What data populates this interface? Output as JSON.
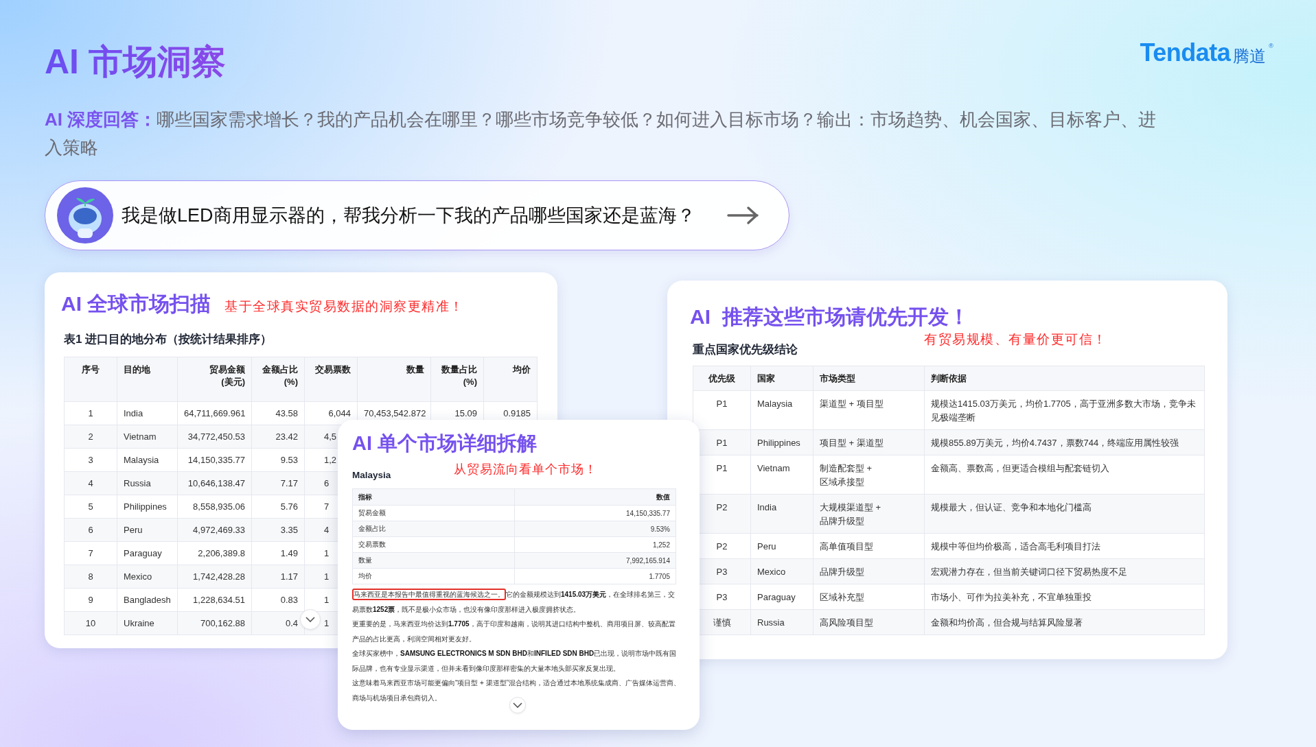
{
  "header": {
    "title": "AI 市场洞察",
    "subtitle": "**AI 深度回答：**哪些国家需求增长？我的产品机会在哪里？哪些市场竞争较低？如何进入目标市场？输出：市场趋势、机会国家、目标客户、进入策略"
  },
  "logo": {
    "name": "Tendata",
    "cn": "腾道",
    "mark": "®"
  },
  "prompt": {
    "text": "我是做LED商用显示器的，帮我分析一下我的产品哪些国家还是蓝海？"
  },
  "scan_card": {
    "title": "AI 全球市场扫描",
    "tagline": "基于全球真实贸易数据的洞察更精准！",
    "table_title": "表1 进口目的地分布（按统计结果排序）",
    "columns": [
      "序号",
      "目的地",
      "贸易金额\n(美元)",
      "金额占比\n(%)",
      "交易票数",
      "数量",
      "数量占比\n(%)",
      "均价"
    ],
    "rows": [
      [
        "1",
        "India",
        "64,711,669.961",
        "43.58",
        "6,044",
        "70,453,542.872",
        "15.09",
        "0.9185"
      ],
      [
        "2",
        "Vietnam",
        "34,772,450.53",
        "23.42",
        "4,5"
      ],
      [
        "3",
        "Malaysia",
        "14,150,335.77",
        "9.53",
        "1,2"
      ],
      [
        "4",
        "Russia",
        "10,646,138.47",
        "7.17",
        "6"
      ],
      [
        "5",
        "Philippines",
        "8,558,935.06",
        "5.76",
        "7"
      ],
      [
        "6",
        "Peru",
        "4,972,469.33",
        "3.35",
        "4"
      ],
      [
        "7",
        "Paraguay",
        "2,206,389.8",
        "1.49",
        "1"
      ],
      [
        "8",
        "Mexico",
        "1,742,428.28",
        "1.17",
        "1"
      ],
      [
        "9",
        "Bangladesh",
        "1,228,634.51",
        "0.83",
        "1"
      ],
      [
        "10",
        "Ukraine",
        "700,162.88",
        "0.4",
        "1"
      ]
    ]
  },
  "detail_card": {
    "title": "AI 单个市场详细拆解",
    "tagline": "从贸易流向看单个市场！",
    "market": "Malaysia",
    "columns": [
      "指标",
      "数值"
    ],
    "rows": [
      [
        "贸易金额",
        "14,150,335.77"
      ],
      [
        "金额占比",
        "9.53%"
      ],
      [
        "交易票数",
        "1,252"
      ],
      [
        "数量",
        "7,992,165.914"
      ],
      [
        "均价",
        "1.7705"
      ]
    ],
    "paragraphs": [
      {
        "highlight": "马来西亚是本报告中最值得重视的蓝海候选之一。",
        "text": "它的金额规模达到**1415.03万美元**，在全球排名第三，交易票数**1252票**，既不是极小众市场，也没有像印度那样进入极度拥挤状态。"
      },
      {
        "text": "更重要的是，马来西亚均价达到**1.7705**，高于印度和越南，说明其进口结构中整机、商用项目屏、较高配置产品的占比更高，利润空间相对更友好。"
      },
      {
        "text": "全球买家榜中，**SAMSUNG ELECTRONICS M SDN BHD**和**INFILED SDN BHD**已出现，说明市场中既有国际品牌，也有专业显示渠道，但并未看到像印度那样密集的大量本地头部买家反复出现。"
      },
      {
        "text": "这意味着马来西亚市场可能更偏向“项目型 + 渠道型”混合结构，适合通过本地系统集成商、广告媒体运营商、商场与机场项目承包商切入。"
      }
    ]
  },
  "priority_card": {
    "title": "AI  推荐这些市场请优先开发！",
    "tagline": "有贸易规模、有量价更可信！",
    "table_title": "重点国家优先级结论",
    "columns": [
      "优先级",
      "国家",
      "市场类型",
      "判断依据"
    ],
    "rows": [
      [
        "P1",
        "Malaysia",
        "渠道型 + 项目型",
        "规模达1415.03万美元，均价1.7705，高于亚洲多数大市场，竞争未见极端垄断"
      ],
      [
        "P1",
        "Philippines",
        "项目型 + 渠道型",
        "规模855.89万美元，均价4.7437，票数744，终端应用属性较强"
      ],
      [
        "P1",
        "Vietnam",
        "制造配套型 +\n区域承接型",
        "金额高、票数高，但更适合模组与配套链切入"
      ],
      [
        "P2",
        "India",
        "大规模渠道型 +\n品牌升级型",
        "规模最大，但认证、竞争和本地化门槛高"
      ],
      [
        "P2",
        "Peru",
        "高单值项目型",
        "规模中等但均价极高，适合高毛利项目打法"
      ],
      [
        "P3",
        "Mexico",
        "品牌升级型",
        "宏观潜力存在，但当前关键词口径下贸易热度不足"
      ],
      [
        "P3",
        "Paraguay",
        "区域补充型",
        "市场小、可作为拉美补充，不宜单独重投"
      ],
      [
        "谨慎",
        "Russia",
        "高风险项目型",
        "金额和均价高，但合规与结算风险显著"
      ]
    ]
  }
}
